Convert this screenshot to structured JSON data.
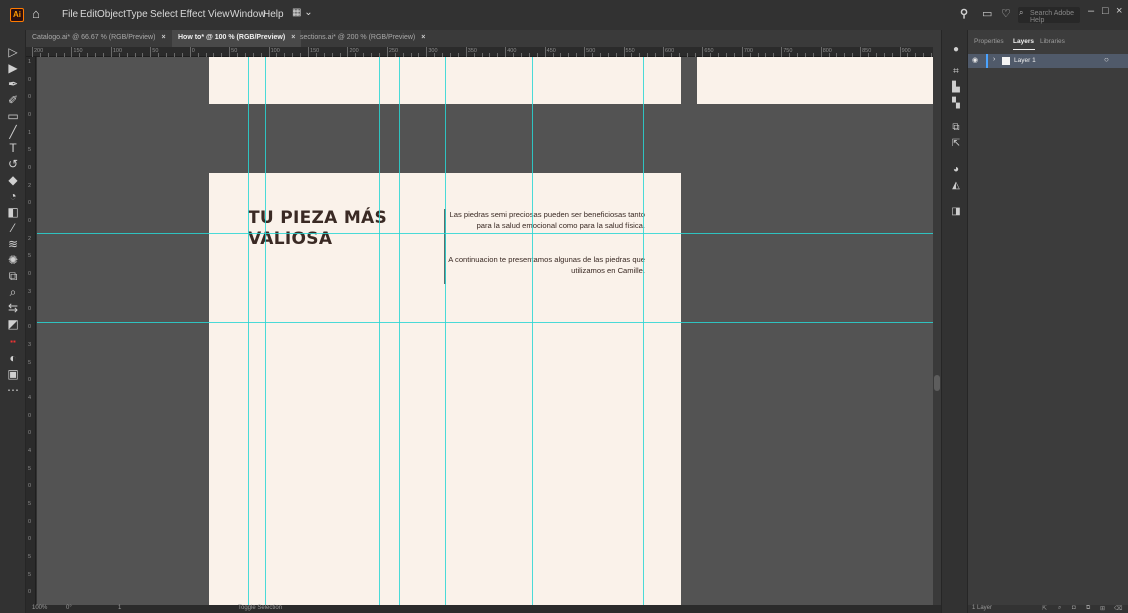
{
  "app": {
    "logo": "Ai",
    "menus": [
      "File",
      "Edit",
      "Object",
      "Type",
      "Select",
      "Effect",
      "View",
      "Window",
      "Help"
    ],
    "search_placeholder": "Search Adobe Help"
  },
  "tabs": [
    {
      "label": "Catalogo.ai* @ 66.67 % (RGB/Preview)",
      "active": false
    },
    {
      "label": "How to* @ 100 % (RGB/Preview)",
      "active": true
    },
    {
      "label": "sections.ai* @ 200 % (RGB/Preview)",
      "active": false
    }
  ],
  "ruler": {
    "h_labels": [
      "200",
      "150",
      "100",
      "50",
      "0",
      "50",
      "100",
      "150",
      "200",
      "250",
      "300",
      "350",
      "400",
      "450",
      "500",
      "550",
      "600",
      "650",
      "700",
      "750",
      "800",
      "850",
      "900"
    ],
    "v_labels": [
      "1",
      "0",
      "0",
      "0",
      "1",
      "5",
      "0",
      "2",
      "0",
      "0",
      "2",
      "5",
      "0",
      "3",
      "0",
      "0",
      "3",
      "5",
      "0",
      "4",
      "0",
      "0",
      "4",
      "5",
      "0",
      "5",
      "0",
      "0",
      "5",
      "5",
      "0"
    ]
  },
  "artboard": {
    "heading": "TU PIEZA MÁS VALIOSA",
    "paragraph1": "Las piedras semi preciosas pueden ser beneficiosas tanto para la salud emocional como para la salud física.",
    "paragraph2": "A continuacion te presentamos algunas de las piedras que utilizamos en Camille."
  },
  "status": {
    "zoom": "100%",
    "angle": "0°",
    "artboard_num": "1",
    "tool": "Toggle Selection"
  },
  "panel": {
    "tabs": [
      "Properties",
      "Layers",
      "Libraries"
    ],
    "active_tab": "Layers",
    "layer_name": "Layer 1",
    "footer_count": "1 Layer"
  },
  "colors": {
    "guide": "#29d6d4",
    "artboard": "#faf2ea",
    "heading": "#3a2a24",
    "accent": "#ff7c00"
  }
}
